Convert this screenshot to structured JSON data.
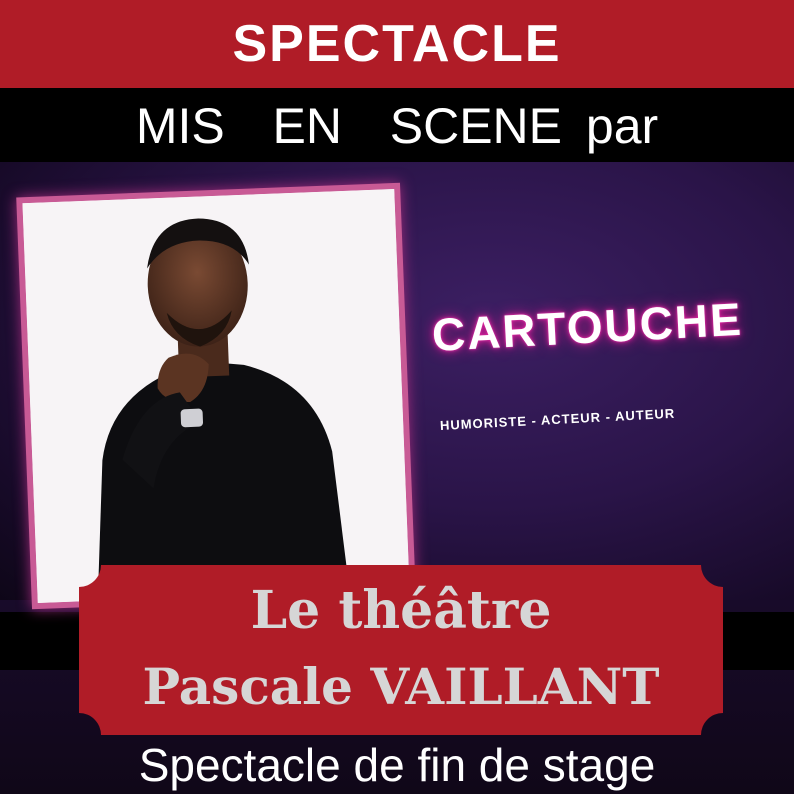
{
  "header": {
    "title": "SPECTACLE",
    "subtitle": "MIS  EN  SCENE par"
  },
  "artist": {
    "name": "CARTOUCHE",
    "roles": "HUMORISTE - ACTEUR - AUTEUR"
  },
  "venue": {
    "line1": "Le théâtre",
    "line2": "Pascale VAILLANT"
  },
  "footer": {
    "text": "Spectacle de fin de stage"
  },
  "colors": {
    "banner_red": "#b01c27",
    "ticket_text": "#d6d6d6",
    "neon_pink": "#e2219f",
    "stage_purple": "#2a1448"
  }
}
